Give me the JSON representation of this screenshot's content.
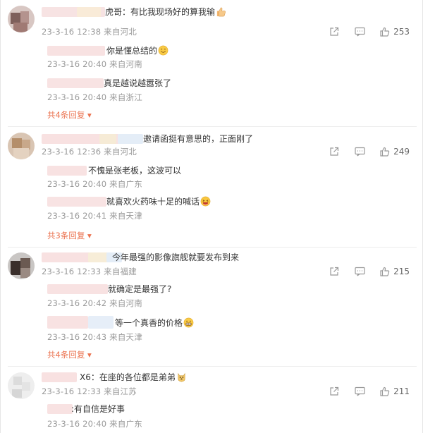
{
  "comments": [
    {
      "text": "虎哥：有比我现场好的算我输",
      "emoji": "thumbs-up-emoji",
      "meta": "23-3-16 12:38 来自河北",
      "likes": "253",
      "replies": [
        {
          "text": "你是懂总结的",
          "emoji": "smile-emoji",
          "meta": "23-3-16 20:40 来自河南"
        },
        {
          "text": "真是越说越嚣张了",
          "emoji": "",
          "meta": "23-3-16 20:40 来自浙江"
        }
      ],
      "expand": "共4条回复"
    },
    {
      "text": "邀请函挺有意思的，正面刚了",
      "emoji": "",
      "meta": "23-3-16 12:36 来自河北",
      "likes": "249",
      "replies": [
        {
          "text": "不愧是张老板，这波可以",
          "emoji": "",
          "meta": "23-3-16 20:40 来自广东"
        },
        {
          "text": "就喜欢火药味十足的喊话",
          "emoji": "laugh-emoji",
          "meta": "23-3-16 20:41 来自天津"
        }
      ],
      "expand": "共3条回复"
    },
    {
      "text": "今年最强的影像旗舰就要发布到来",
      "emoji": "",
      "meta": "23-3-16 12:33 来自福建",
      "likes": "215",
      "replies": [
        {
          "text": "就确定是最强了?",
          "emoji": "",
          "meta": "23-3-16 20:42 来自河南"
        },
        {
          "text": "等一个真香的价格",
          "emoji": "grin-emoji",
          "meta": "23-3-16 20:43 来自天津"
        }
      ],
      "expand": "共4条回复"
    },
    {
      "text": "X6：在座的各位都是弟弟",
      "emoji": "doge-emoji",
      "meta": "23-3-16 12:33 来自江苏",
      "likes": "211",
      "replies": [
        {
          "text": ":有自信是好事",
          "emoji": "",
          "meta": "23-3-16 20:40 来自广东"
        }
      ],
      "expand": ""
    }
  ],
  "colors": {
    "expand": "#eb7350",
    "meta": "#999999",
    "divider": "#ededed"
  }
}
